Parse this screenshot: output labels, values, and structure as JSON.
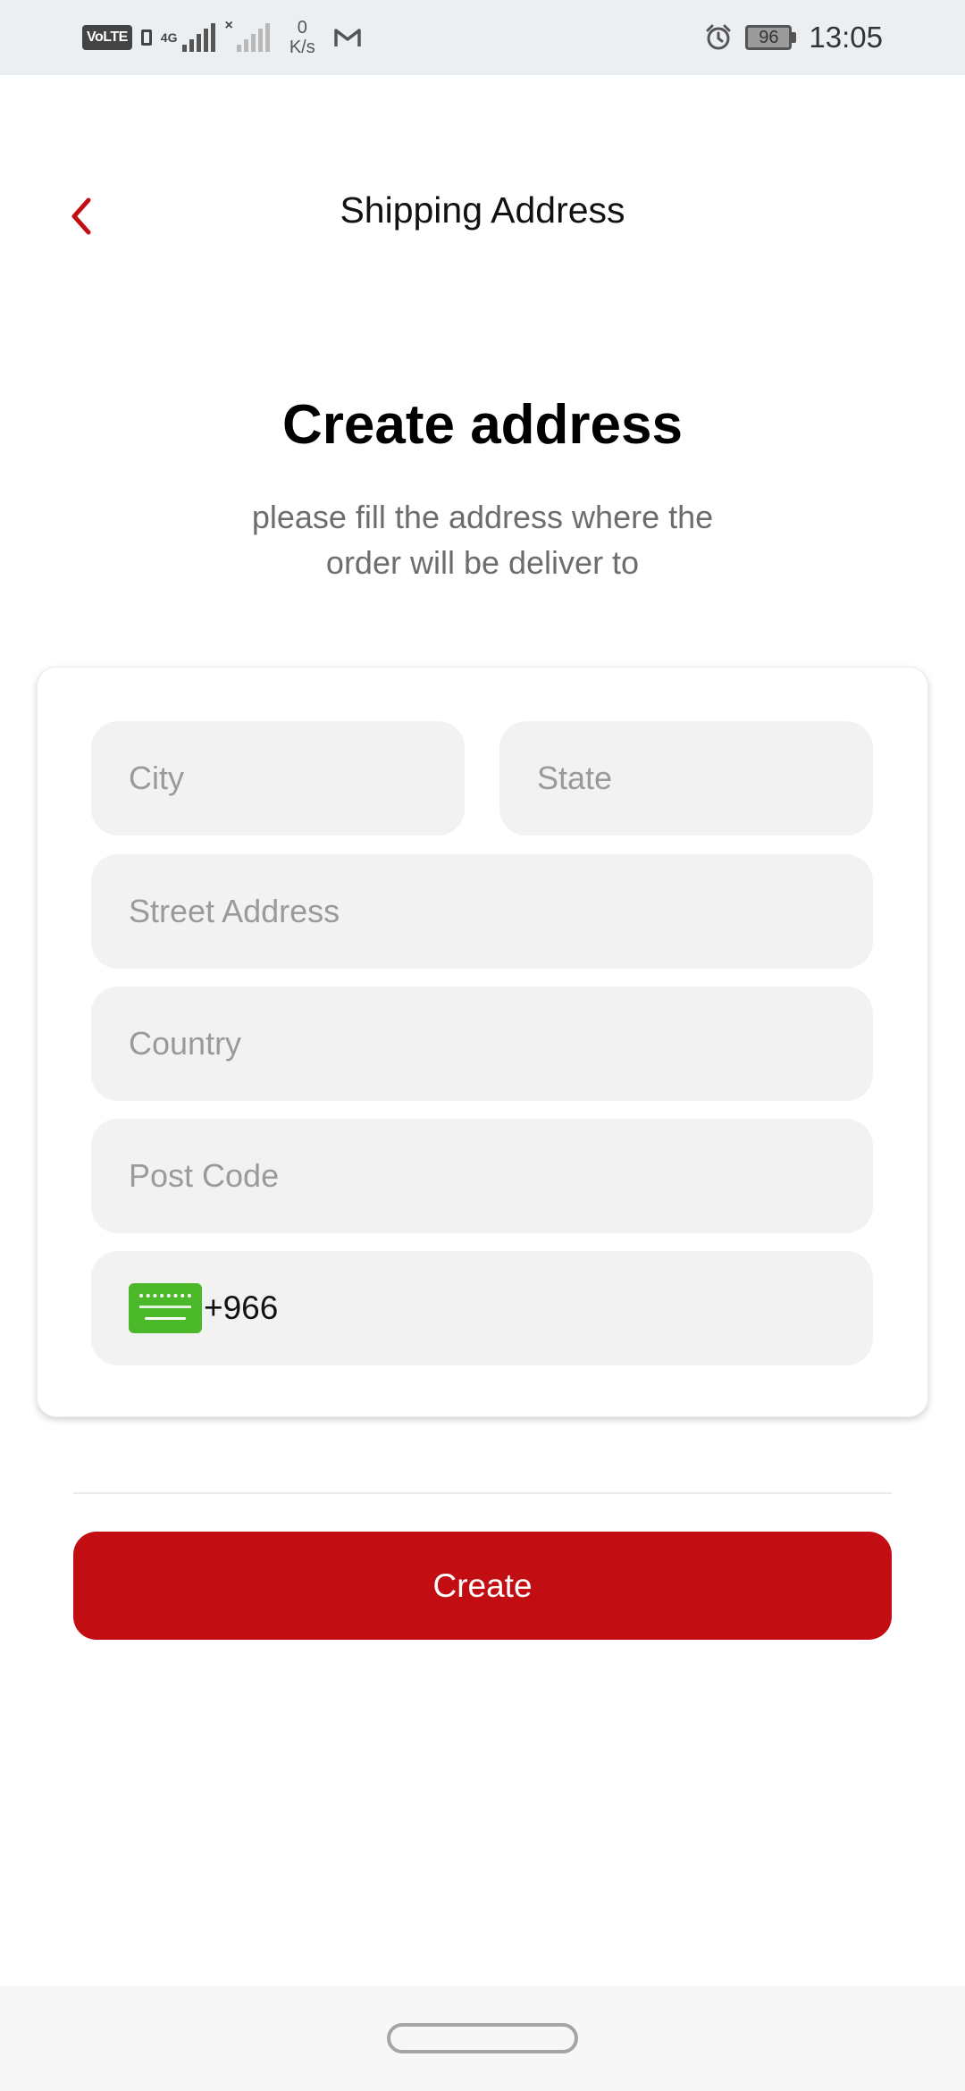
{
  "status_bar": {
    "volte_label": "VoLTE",
    "network_type": "4G",
    "speed_value": "0",
    "speed_unit": "K/s",
    "battery_level": "96",
    "time": "13:05",
    "icons": [
      "volte-icon",
      "signal-icon",
      "gmail-icon",
      "alarm-icon",
      "battery-icon"
    ]
  },
  "header": {
    "title": "Shipping Address",
    "back_icon": "chevron-left-icon"
  },
  "content": {
    "title": "Create address",
    "subtitle_line1": "please fill the address where the",
    "subtitle_line2": "order will be deliver to"
  },
  "form": {
    "city": {
      "placeholder": "City",
      "value": ""
    },
    "state": {
      "placeholder": "State",
      "value": ""
    },
    "street": {
      "placeholder": "Street Address",
      "value": ""
    },
    "country": {
      "placeholder": "Country",
      "value": ""
    },
    "post_code": {
      "placeholder": "Post Code",
      "value": ""
    },
    "phone": {
      "country_flag": "saudi-arabia-flag-icon",
      "dial_code": "+966",
      "value": ""
    }
  },
  "actions": {
    "create_label": "Create"
  },
  "colors": {
    "accent": "#c20e13",
    "field_background": "#f2f2f2",
    "placeholder": "#9a9a9a",
    "subtitle": "#6d6d6d",
    "flag_green": "#4bb829"
  }
}
